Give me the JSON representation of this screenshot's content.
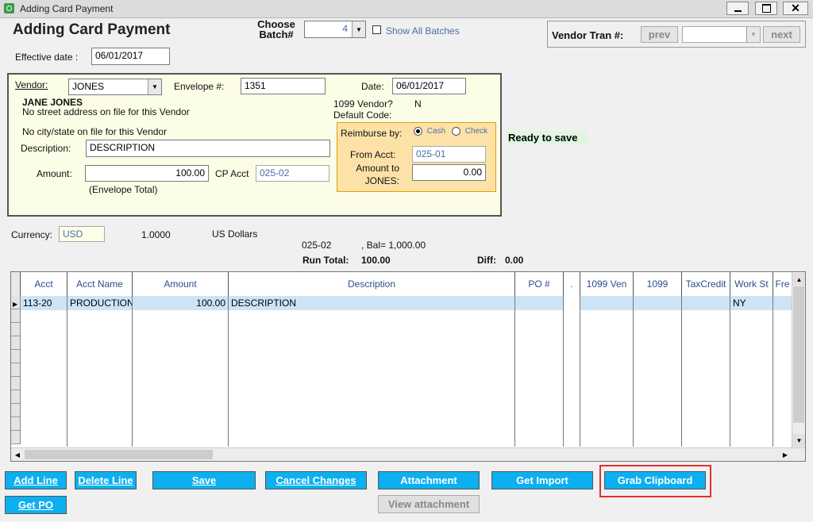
{
  "window": {
    "title": "Adding Card Payment"
  },
  "header": {
    "title": "Adding Card Payment",
    "choose_batch_label_1": "Choose",
    "choose_batch_label_2": "Batch#",
    "batch_value": "4",
    "show_all_batches_label": "Show All Batches",
    "vendor_tran_label": "Vendor Tran #:",
    "prev_label": "prev",
    "next_label": "next",
    "effective_date_label": "Effective date :",
    "effective_date_value": "06/01/2017"
  },
  "vendor": {
    "vendor_label": "Vendor:",
    "vendor_value": "JONES",
    "envelope_label": "Envelope #:",
    "envelope_value": "1351",
    "date_label": "Date:",
    "date_value": "06/01/2017",
    "name": "JANE JONES",
    "no_street": "No street address on file for this Vendor",
    "no_city": "No city/state on file for this Vendor",
    "v1099_label": "1099 Vendor?",
    "v1099_value": "N",
    "default_code_label": "Default Code:",
    "description_label": "Description:",
    "description_value": "DESCRIPTION",
    "amount_label": "Amount:",
    "amount_value": "100.00",
    "cp_acct_label": "CP Acct",
    "cp_acct_value": "025-02",
    "envelope_total": "(Envelope Total)"
  },
  "reimburse": {
    "label": "Reimburse by:",
    "cash_label": "Cash",
    "check_label": "Check",
    "from_acct_label": "From Acct:",
    "from_acct_value": "025-01",
    "amount_to_label": "Amount to",
    "amount_to_name": "JONES:",
    "amount_to_value": "0.00"
  },
  "status": {
    "ready": "Ready to save"
  },
  "currency": {
    "label": "Currency:",
    "code": "USD",
    "rate": "1.0000",
    "name": "US Dollars",
    "acct": "025-02",
    "bal": ",  Bal= 1,000.00",
    "run_total_label": "Run Total:",
    "run_total_value": "100.00",
    "diff_label": "Diff:",
    "diff_value": "0.00"
  },
  "grid": {
    "columns": [
      "Acct",
      "Acct Name",
      "Amount",
      "Description",
      "PO #",
      ".",
      "1099 Ven",
      "1099",
      "TaxCredit",
      "Work St",
      "Fre"
    ],
    "rows": [
      {
        "acct": "113-20",
        "acct_name": "PRODUCTION",
        "amount": "100.00",
        "description": "DESCRIPTION",
        "po": "",
        "dot": "",
        "v1099": "",
        "c1099": "",
        "taxcredit": "",
        "workst": "NY",
        "fre": ""
      }
    ]
  },
  "buttons": {
    "add_line": "Add Line",
    "delete_line": "Delete Line",
    "save": "Save",
    "cancel_changes": "Cancel Changes",
    "attachment": "Attachment",
    "get_import": "Get Import",
    "grab_clipboard": "Grab Clipboard",
    "get_po": "Get PO",
    "view_attachment": "View attachment"
  },
  "colors": {
    "button_bg": "#0cb0f0",
    "vendor_box_bg": "#fcfde6",
    "reimburse_bg": "#fde2a8",
    "ready_bg": "#e0f6e0",
    "highlight": "#e03030"
  }
}
